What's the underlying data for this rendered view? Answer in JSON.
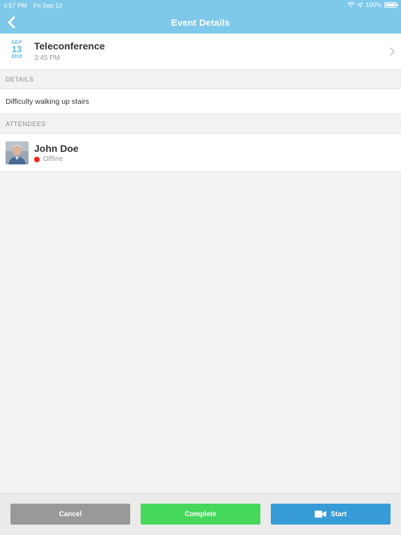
{
  "status_bar": {
    "time": "4:57 PM",
    "date": "Fri Sep 13",
    "battery": "100%",
    "icons": [
      "wifi-icon",
      "location-arrow-icon",
      "battery-icon"
    ]
  },
  "navbar": {
    "title": "Event Details",
    "back_icon": "chevron-left-icon",
    "color": "#7ec8ea"
  },
  "event": {
    "month": "SEP",
    "day": "13",
    "year": "2019",
    "title": "Teleconference",
    "time": "3:45 PM",
    "chevron_icon": "chevron-right-icon",
    "accent": "#5bb9e4"
  },
  "sections": {
    "details_header": "DETAILS",
    "details_text": "Difficulty walking up stairs",
    "attendees_header": "ATTENDEES"
  },
  "attendees": [
    {
      "name": "John Doe",
      "status": "Offline",
      "status_color": "#e8281a"
    }
  ],
  "actions": {
    "cancel": "Cancel",
    "complete": "Complete",
    "start": "Start",
    "start_icon": "video-camera-icon",
    "colors": {
      "cancel": "#999999",
      "complete": "#46d85b",
      "start": "#379bd7"
    }
  }
}
